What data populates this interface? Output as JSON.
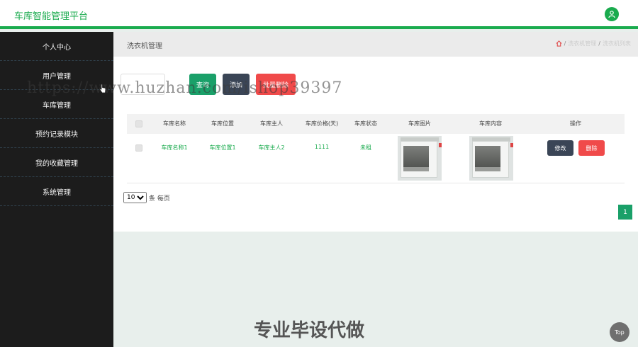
{
  "app": {
    "title": "车库智能管理平台"
  },
  "sidebar": {
    "items": [
      {
        "label": "个人中心"
      },
      {
        "label": "用户管理"
      },
      {
        "label": "车库管理"
      },
      {
        "label": "预约记录模块"
      },
      {
        "label": "我的收藏管理"
      },
      {
        "label": "系统管理"
      }
    ]
  },
  "breadcrumb": {
    "title": "洗衣机管理",
    "path": [
      "洗衣机管理",
      "洗衣机列表"
    ]
  },
  "toolbar": {
    "search_placeholder": "",
    "query_label": "查询",
    "add_label": "添加",
    "batch_delete_label": "批量删除"
  },
  "table": {
    "columns": [
      "车库名称",
      "车库位置",
      "车库主人",
      "车库价格(天)",
      "车库状态",
      "车库图片",
      "车库内容",
      "操作"
    ],
    "rows": [
      {
        "name": "车库名称1",
        "location": "车库位置1",
        "owner": "车库主人2",
        "price": "1111",
        "status": "未租",
        "edit_label": "修改",
        "delete_label": "删除"
      }
    ]
  },
  "pagination": {
    "page_size": "10",
    "page_size_options": [
      "10"
    ],
    "page_size_suffix": "条 每页",
    "current_page": "1"
  },
  "watermarks": {
    "url": "https://www.huzhan.com/ishop39397",
    "slogan": "专业毕设代做"
  },
  "back_to_top": "Top",
  "colors": {
    "accent": "#1aab4e",
    "danger": "#f04a4a",
    "dark": "#3a4556",
    "sidebar": "#1c1c1c"
  }
}
